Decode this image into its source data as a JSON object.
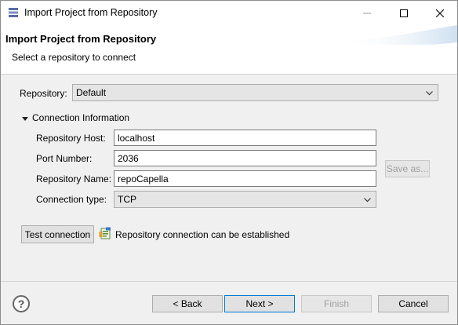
{
  "window": {
    "title": "Import Project from Repository",
    "controls": {
      "minimize": "minimize",
      "maximize": "maximize",
      "close": "close"
    }
  },
  "banner": {
    "title": "Import Project from Repository",
    "subtitle": "Select a repository to connect"
  },
  "form": {
    "repository_label": "Repository:",
    "repository_value": "Default",
    "section_label": "Connection Information",
    "host_label": "Repository Host:",
    "host_value": "localhost",
    "port_label": "Port Number:",
    "port_value": "2036",
    "name_label": "Repository Name:",
    "name_value": "repoCapella",
    "conn_type_label": "Connection type:",
    "conn_type_value": "TCP",
    "save_as_label": "Save as...",
    "test_connection_label": "Test connection",
    "status_text": "Repository connection can be established"
  },
  "footer": {
    "help_label": "?",
    "back_label": "< Back",
    "next_label": "Next >",
    "finish_label": "Finish",
    "cancel_label": "Cancel"
  }
}
